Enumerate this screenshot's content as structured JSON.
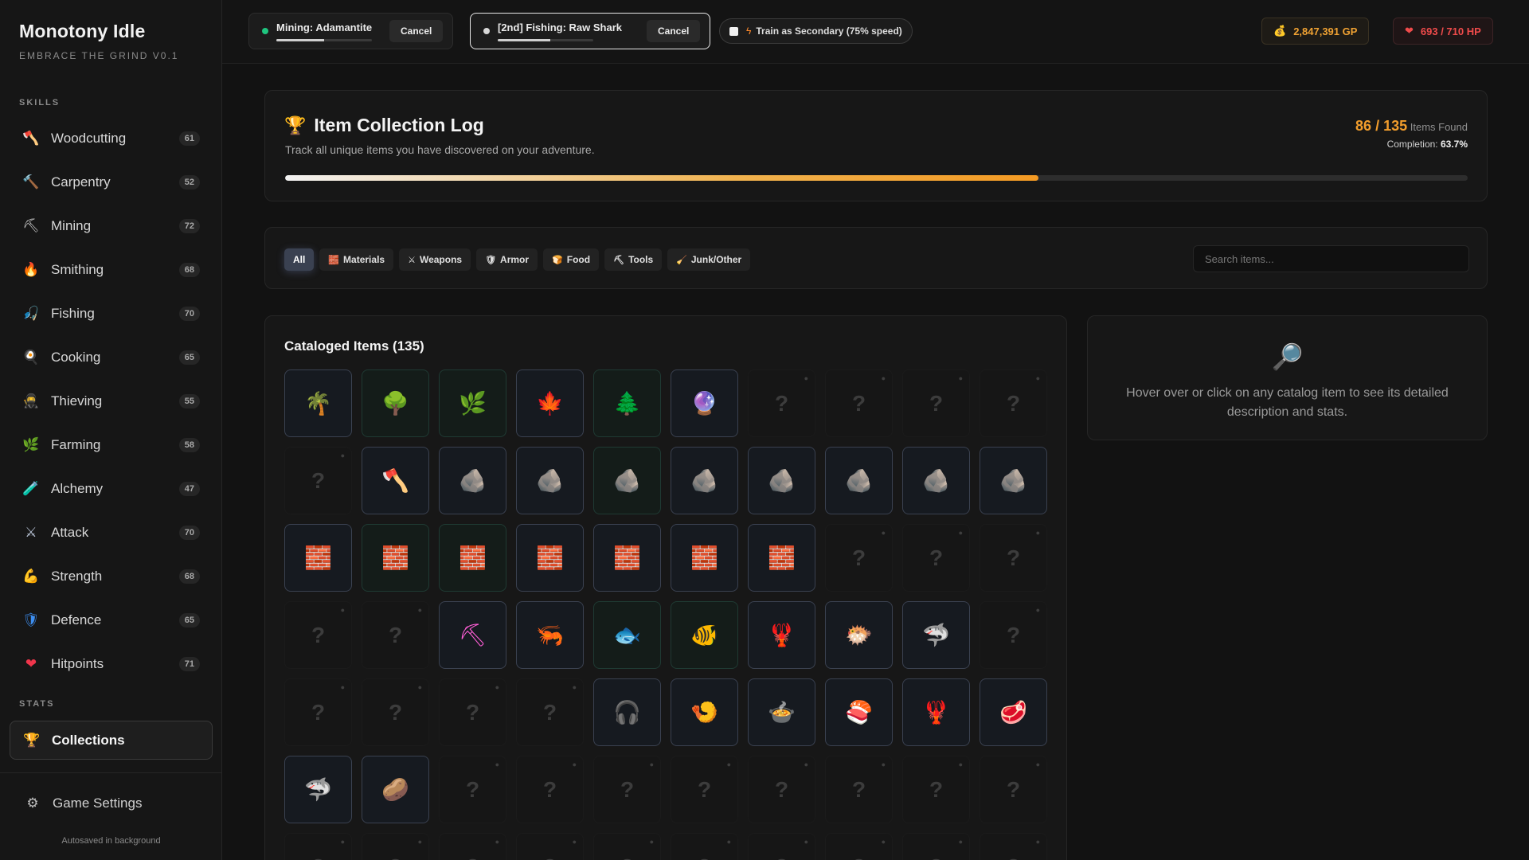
{
  "app": {
    "title": "Monotony Idle",
    "subtitle": "EMBRACE THE GRIND V0.1"
  },
  "sidebar": {
    "skills_label": "SKILLS",
    "stats_label": "STATS",
    "skills": [
      {
        "name": "Woodcutting",
        "level": "61",
        "icon": "axe-icon",
        "glyph": "🪓",
        "color": "#e0443f"
      },
      {
        "name": "Carpentry",
        "level": "52",
        "icon": "hammer-icon",
        "glyph": "🔨",
        "color": "#d8a06a"
      },
      {
        "name": "Mining",
        "level": "72",
        "icon": "pickaxe-icon",
        "glyph": "⛏",
        "color": "#cfcfcf"
      },
      {
        "name": "Smithing",
        "level": "68",
        "icon": "fire-icon",
        "glyph": "🔥",
        "color": "#ff7a1a"
      },
      {
        "name": "Fishing",
        "level": "70",
        "icon": "fishing-hook-icon",
        "glyph": "🎣",
        "color": "#4fa3ff"
      },
      {
        "name": "Cooking",
        "level": "65",
        "icon": "cooking-pot-icon",
        "glyph": "🍳",
        "color": "#b78cff"
      },
      {
        "name": "Thieving",
        "level": "55",
        "icon": "thief-icon",
        "glyph": "🥷",
        "color": "#8a6bd6"
      },
      {
        "name": "Farming",
        "level": "58",
        "icon": "sprout-icon",
        "glyph": "🌿",
        "color": "#5fcf62"
      },
      {
        "name": "Alchemy",
        "level": "47",
        "icon": "potion-icon",
        "glyph": "🧪",
        "color": "#8fe08c"
      },
      {
        "name": "Attack",
        "level": "70",
        "icon": "crossed-swords-icon",
        "glyph": "⚔",
        "color": "#b9c4d6"
      },
      {
        "name": "Strength",
        "level": "68",
        "icon": "flexed-biceps-icon",
        "glyph": "💪",
        "color": "#f4b63b"
      },
      {
        "name": "Defence",
        "level": "65",
        "icon": "shield-icon",
        "glyph": "🛡",
        "color": "#3d8ef0"
      },
      {
        "name": "Hitpoints",
        "level": "71",
        "icon": "heart-icon",
        "glyph": "❤",
        "color": "#f0354b"
      }
    ],
    "collections": {
      "name": "Collections",
      "icon": "trophy-icon",
      "glyph": "🏆"
    },
    "settings": {
      "name": "Game Settings",
      "icon": "gear-icon",
      "glyph": "⚙"
    },
    "autosave": "Autosaved in background"
  },
  "topbar": {
    "task1": {
      "title": "Mining: Adamantite",
      "cancel": "Cancel",
      "dot_color": "#1fc57f",
      "progress": 0.5
    },
    "task2": {
      "title": "[2nd] Fishing: Raw Shark",
      "cancel": "Cancel",
      "dot_color": "#d8d8d8",
      "progress": 0.55
    },
    "train_secondary": "Train as Secondary (75% speed)",
    "gold": "2,847,391 GP",
    "hp": "693 / 710 HP"
  },
  "collection_log": {
    "title": "Item Collection Log",
    "description": "Track all unique items you have discovered on your adventure.",
    "found": "86 / 135",
    "found_label": "Items Found",
    "completion_label": "Completion:",
    "completion": "63.7%",
    "progress": 0.637
  },
  "filters": {
    "buttons": [
      {
        "label": "All",
        "glyph": "",
        "active": true
      },
      {
        "label": "Materials",
        "glyph": "🧱",
        "active": false
      },
      {
        "label": "Weapons",
        "glyph": "⚔",
        "active": false
      },
      {
        "label": "Armor",
        "glyph": "🛡",
        "active": false
      },
      {
        "label": "Food",
        "glyph": "🍞",
        "active": false
      },
      {
        "label": "Tools",
        "glyph": "⛏",
        "active": false
      },
      {
        "label": "Junk/Other",
        "glyph": "🧹",
        "active": false
      }
    ],
    "search_placeholder": "Search items..."
  },
  "catalog": {
    "title": "Cataloged Items (135)",
    "items": [
      {
        "found": true,
        "glyph": "🌴",
        "tint": "blue"
      },
      {
        "found": true,
        "glyph": "🌳",
        "tint": "green"
      },
      {
        "found": true,
        "glyph": "🌿",
        "tint": "green"
      },
      {
        "found": true,
        "glyph": "🍁",
        "tint": "blue"
      },
      {
        "found": true,
        "glyph": "🌲",
        "tint": "green"
      },
      {
        "found": true,
        "glyph": "🔮",
        "tint": "blue"
      },
      {
        "found": false
      },
      {
        "found": false
      },
      {
        "found": false
      },
      {
        "found": false
      },
      {
        "found": false
      },
      {
        "found": true,
        "glyph": "🪓",
        "tint": "blue"
      },
      {
        "found": true,
        "glyph": "🪨",
        "tint": "blue",
        "color": "#d98a3c"
      },
      {
        "found": true,
        "glyph": "🪨",
        "tint": "blue",
        "color": "#e6e6e6"
      },
      {
        "found": true,
        "glyph": "🪨",
        "tint": "green",
        "color": "#8a8a8a"
      },
      {
        "found": true,
        "glyph": "🪨",
        "tint": "blue",
        "color": "#2a2a2a"
      },
      {
        "found": true,
        "glyph": "🪨",
        "tint": "blue",
        "color": "#f0d020"
      },
      {
        "found": true,
        "glyph": "🪨",
        "tint": "blue",
        "color": "#4fb3ff"
      },
      {
        "found": true,
        "glyph": "🪨",
        "tint": "blue",
        "color": "#3ccf63"
      },
      {
        "found": true,
        "glyph": "🪨",
        "tint": "blue",
        "color": "#ff6bd8"
      },
      {
        "found": true,
        "glyph": "🧱",
        "tint": "blue",
        "color": "#e08a3a"
      },
      {
        "found": true,
        "glyph": "🧱",
        "tint": "green",
        "color": "#8c8c8c"
      },
      {
        "found": true,
        "glyph": "🧱",
        "tint": "green",
        "color": "#cfcfcf"
      },
      {
        "found": true,
        "glyph": "🧱",
        "tint": "blue",
        "color": "#f0d21a"
      },
      {
        "found": true,
        "glyph": "🧱",
        "tint": "blue",
        "color": "#4fc0ff"
      },
      {
        "found": true,
        "glyph": "🧱",
        "tint": "blue",
        "color": "#39d15a"
      },
      {
        "found": true,
        "glyph": "🧱",
        "tint": "blue",
        "color": "#ff7be3"
      },
      {
        "found": false
      },
      {
        "found": false
      },
      {
        "found": false
      },
      {
        "found": false
      },
      {
        "found": false
      },
      {
        "found": true,
        "glyph": "⛏",
        "tint": "blue",
        "color": "#ff5ed6"
      },
      {
        "found": true,
        "glyph": "🦐",
        "tint": "blue"
      },
      {
        "found": true,
        "glyph": "🐟",
        "tint": "green"
      },
      {
        "found": true,
        "glyph": "🐠",
        "tint": "green"
      },
      {
        "found": true,
        "glyph": "🦞",
        "tint": "blue",
        "color": "#2f6b3c"
      },
      {
        "found": true,
        "glyph": "🐡",
        "tint": "blue"
      },
      {
        "found": true,
        "glyph": "🦈",
        "tint": "blue"
      },
      {
        "found": false
      },
      {
        "found": false
      },
      {
        "found": false
      },
      {
        "found": false
      },
      {
        "found": false
      },
      {
        "found": true,
        "glyph": "🎧",
        "tint": "blue"
      },
      {
        "found": true,
        "glyph": "🍤",
        "tint": "blue"
      },
      {
        "found": true,
        "glyph": "🍲",
        "tint": "blue"
      },
      {
        "found": true,
        "glyph": "🍣",
        "tint": "blue"
      },
      {
        "found": true,
        "glyph": "🦞",
        "tint": "blue"
      },
      {
        "found": true,
        "glyph": "🥩",
        "tint": "blue"
      },
      {
        "found": true,
        "glyph": "🦈",
        "tint": "blue"
      },
      {
        "found": true,
        "glyph": "🥔",
        "tint": "blue"
      },
      {
        "found": false
      },
      {
        "found": false
      },
      {
        "found": false
      },
      {
        "found": false
      },
      {
        "found": false
      },
      {
        "found": false
      },
      {
        "found": false
      },
      {
        "found": false
      },
      {
        "found": false
      },
      {
        "found": false
      },
      {
        "found": false
      },
      {
        "found": false
      },
      {
        "found": false
      },
      {
        "found": false
      },
      {
        "found": false
      },
      {
        "found": false
      },
      {
        "found": false
      },
      {
        "found": false
      }
    ],
    "locked_glyph": "?",
    "lock_glyph": "🔒"
  },
  "detail": {
    "icon": "magnifier-icon",
    "glyph": "🔎",
    "text": "Hover over or click on any catalog item to see its detailed description and stats."
  }
}
